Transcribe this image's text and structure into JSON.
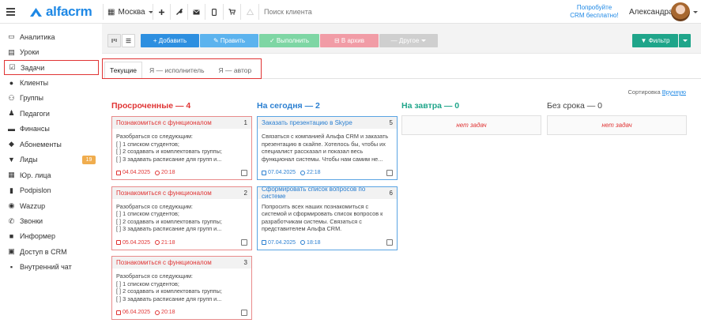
{
  "header": {
    "brand": "alfacrm",
    "city": "Москва",
    "search_placeholder": "Поиск клиента",
    "promo_line1": "Попробуйте",
    "promo_line2": "CRM бесплатно!",
    "user_name": "Александра",
    "icons": [
      "plus-icon",
      "wrench-icon",
      "envelope-icon",
      "mobile-icon",
      "cart-icon",
      "warning-icon"
    ]
  },
  "sidebar": {
    "items": [
      {
        "label": "Аналитика",
        "icon": "analytics-icon",
        "glyph": "▭"
      },
      {
        "label": "Уроки",
        "icon": "book-icon",
        "glyph": "▤"
      },
      {
        "label": "Задачи",
        "icon": "tasks-icon",
        "glyph": "☑"
      },
      {
        "label": "Клиенты",
        "icon": "user-icon",
        "glyph": "●"
      },
      {
        "label": "Группы",
        "icon": "group-icon",
        "glyph": "⚇"
      },
      {
        "label": "Педагоги",
        "icon": "teacher-icon",
        "glyph": "♟"
      },
      {
        "label": "Финансы",
        "icon": "money-icon",
        "glyph": "▬"
      },
      {
        "label": "Абонементы",
        "icon": "tag-icon",
        "glyph": "◆"
      },
      {
        "label": "Лиды",
        "icon": "funnel-icon",
        "glyph": "▼",
        "badge": "19"
      },
      {
        "label": "Юр. лица",
        "icon": "building-icon",
        "glyph": "▦"
      },
      {
        "label": "Podpislon",
        "icon": "document-icon",
        "glyph": "▮"
      },
      {
        "label": "Wazzup",
        "icon": "chat-icon",
        "glyph": "◉"
      },
      {
        "label": "Звонки",
        "icon": "phone-icon",
        "glyph": "✆"
      },
      {
        "label": "Информер",
        "icon": "info-icon",
        "glyph": "■"
      },
      {
        "label": "Доступ в CRM",
        "icon": "lock-icon",
        "glyph": "▣"
      },
      {
        "label": "Внутренний чат",
        "icon": "comment-icon",
        "glyph": "▪"
      }
    ],
    "active_index": 2
  },
  "toolbar": {
    "add": "+ Добавить",
    "edit": "✎ Править",
    "done": "✓ Выполнить",
    "archive": "⊟ В архив",
    "other": "— Другое",
    "filter": "▼ Фильтр"
  },
  "tabs": [
    {
      "label": "Текущие",
      "active": true
    },
    {
      "label": "Я — исполнитель",
      "active": false
    },
    {
      "label": "Я — автор",
      "active": false
    }
  ],
  "sort": {
    "label": "Сортировка",
    "value": "Вручную"
  },
  "columns": [
    {
      "title": "Просроченные — 4",
      "kind": "over",
      "cards": [
        {
          "title": "Познакомиться с функционалом",
          "num": "1",
          "lines": [
            "Разобраться со следующим:",
            "[ ] 1 списком студентов;",
            "[ ] 2 создавать и комплектовать группы;",
            "[ ] 3 задавать расписание для групп и..."
          ],
          "date": "04.04.2025",
          "time": "20:18"
        },
        {
          "title": "Познакомиться с функционалом",
          "num": "2",
          "lines": [
            "Разобраться со следующим:",
            "[ ] 1 списком студентов;",
            "[ ] 2 создавать и комплектовать группы;",
            "[ ] 3 задавать расписание для групп и..."
          ],
          "date": "05.04.2025",
          "time": "21:18"
        },
        {
          "title": "Познакомиться с функционалом",
          "num": "3",
          "lines": [
            "Разобраться со следующим:",
            "[ ] 1 списком студентов;",
            "[ ] 2 создавать и комплектовать группы;",
            "[ ] 3 задавать расписание для групп и..."
          ],
          "date": "06.04.2025",
          "time": "20:18"
        }
      ]
    },
    {
      "title": "На сегодня — 2",
      "kind": "today",
      "cards": [
        {
          "title": "Заказать презентацию в Skype",
          "num": "5",
          "lines": [
            "Связаться с компанией Альфа CRM и заказать",
            "презентацию в скайпе. Хотелось бы, чтобы их",
            "специалист рассказал и показал весь",
            "функционал системы. Чтобы нам самим не..."
          ],
          "date": "07.04.2025",
          "time": "22:18"
        },
        {
          "title": "Сформировать список вопросов по системе",
          "num": "6",
          "lines": [
            "Попросить всех наших познакомиться с",
            "системой и сформировать список вопросов к",
            "разработчикам системы. Связаться с",
            "представителем Альфа CRM."
          ],
          "date": "07.04.2025",
          "time": "18:18"
        }
      ]
    },
    {
      "title": "На завтра — 0",
      "kind": "tomorrow",
      "empty": "нет задач"
    },
    {
      "title": "Без срока — 0",
      "kind": "nodate",
      "empty": "нет задач"
    }
  ]
}
